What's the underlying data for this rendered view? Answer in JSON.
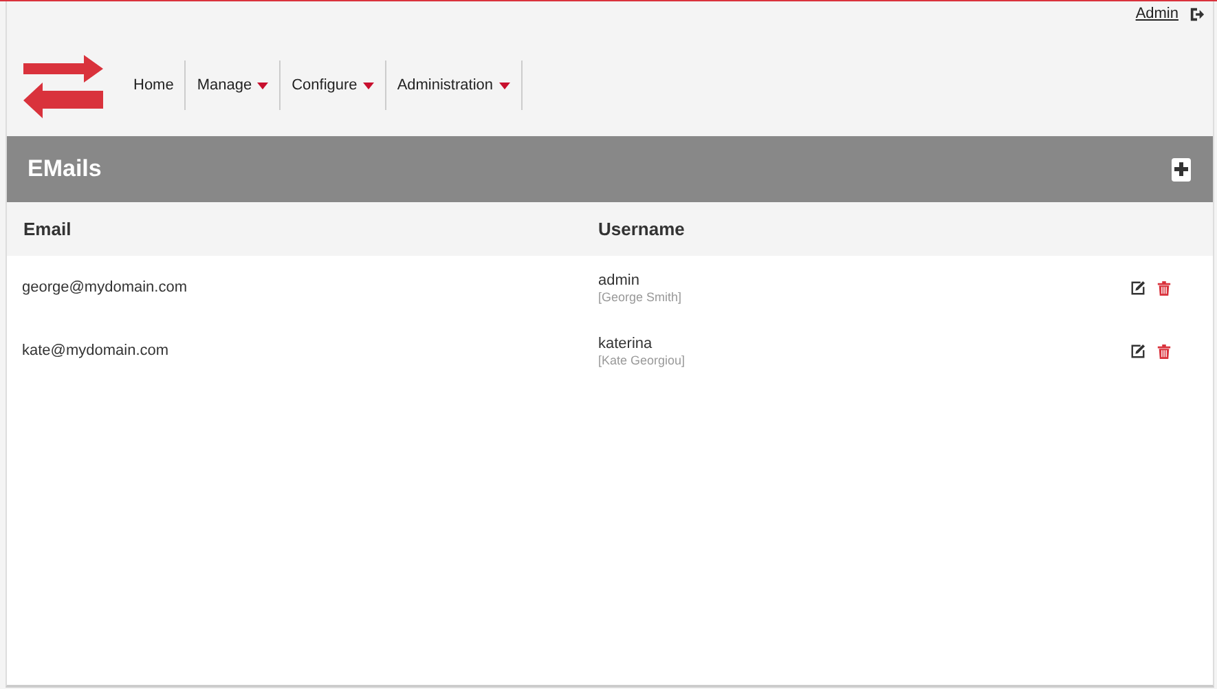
{
  "user": {
    "name": "Admin"
  },
  "nav": [
    {
      "label": "Home",
      "dropdown": false
    },
    {
      "label": "Manage",
      "dropdown": true
    },
    {
      "label": "Configure",
      "dropdown": true
    },
    {
      "label": "Administration",
      "dropdown": true
    }
  ],
  "panel": {
    "title": "EMails"
  },
  "table": {
    "columns": [
      "Email",
      "Username"
    ],
    "rows": [
      {
        "email": "george@mydomain.com",
        "username": "admin",
        "full_name": "[George Smith]"
      },
      {
        "email": "kate@mydomain.com",
        "username": "katerina",
        "full_name": "[Kate Georgiou]"
      }
    ]
  }
}
